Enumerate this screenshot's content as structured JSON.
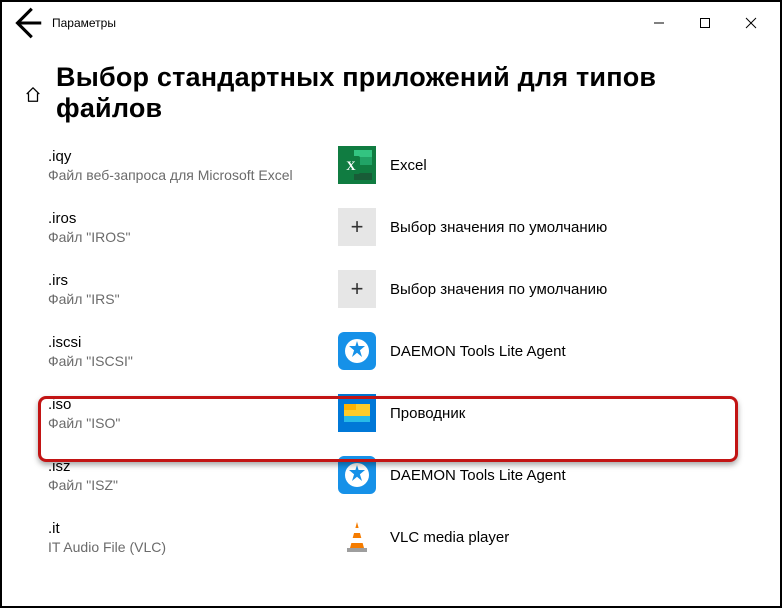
{
  "window": {
    "title": "Параметры"
  },
  "page": {
    "heading": "Выбор стандартных приложений для типов файлов"
  },
  "rows": [
    {
      "ext": ".iqy",
      "desc": "Файл веб-запроса для Microsoft Excel",
      "app": "Excel",
      "icon": "excel"
    },
    {
      "ext": ".iros",
      "desc": "Файл \"IROS\"",
      "app": "Выбор значения по умолчанию",
      "icon": "plus"
    },
    {
      "ext": ".irs",
      "desc": "Файл \"IRS\"",
      "app": "Выбор значения по умолчанию",
      "icon": "plus"
    },
    {
      "ext": ".iscsi",
      "desc": "Файл \"ISCSI\"",
      "app": "DAEMON Tools Lite Agent",
      "icon": "daemon"
    },
    {
      "ext": ".iso",
      "desc": "Файл \"ISO\"",
      "app": "Проводник",
      "icon": "explorer"
    },
    {
      "ext": ".isz",
      "desc": "Файл \"ISZ\"",
      "app": "DAEMON Tools Lite Agent",
      "icon": "daemon"
    },
    {
      "ext": ".it",
      "desc": "IT Audio File (VLC)",
      "app": "VLC media player",
      "icon": "vlc"
    }
  ]
}
